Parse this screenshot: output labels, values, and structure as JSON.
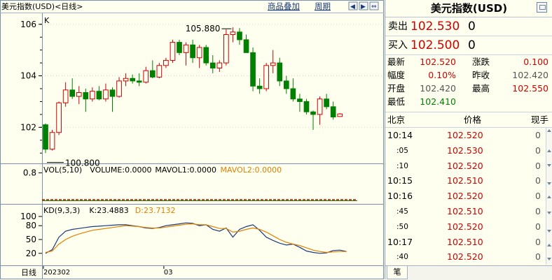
{
  "header": {
    "title": "美元指数(USD)<日线>",
    "overlay_label": "商品叠加",
    "period_label": "周期"
  },
  "chart_data": [
    {
      "type": "candlestick",
      "title": "K",
      "ylim": [
        100.6,
        106.4
      ],
      "yticks": [
        102,
        104,
        106
      ],
      "up_color": "#d00000",
      "down_color": "#008000",
      "candles": [
        {
          "o": 102.1,
          "h": 102.15,
          "l": 101.0,
          "c": 101.15
        },
        {
          "o": 101.15,
          "h": 101.9,
          "l": 101.1,
          "c": 101.8
        },
        {
          "o": 101.8,
          "h": 103.0,
          "l": 101.7,
          "c": 102.95
        },
        {
          "o": 102.95,
          "h": 103.75,
          "l": 102.8,
          "c": 103.45
        },
        {
          "o": 103.45,
          "h": 103.9,
          "l": 103.1,
          "c": 103.2
        },
        {
          "o": 103.2,
          "h": 103.6,
          "l": 102.9,
          "c": 103.35
        },
        {
          "o": 103.35,
          "h": 103.5,
          "l": 102.6,
          "c": 103.1
        },
        {
          "o": 103.1,
          "h": 103.55,
          "l": 103.0,
          "c": 103.4
        },
        {
          "o": 103.4,
          "h": 103.6,
          "l": 103.05,
          "c": 103.1
        },
        {
          "o": 103.1,
          "h": 103.7,
          "l": 103.0,
          "c": 103.45
        },
        {
          "o": 103.45,
          "h": 103.55,
          "l": 102.6,
          "c": 103.2
        },
        {
          "o": 103.2,
          "h": 103.95,
          "l": 103.15,
          "c": 103.8
        },
        {
          "o": 103.8,
          "h": 104.1,
          "l": 103.6,
          "c": 103.9
        },
        {
          "o": 103.9,
          "h": 104.05,
          "l": 103.7,
          "c": 103.8
        },
        {
          "o": 103.8,
          "h": 104.1,
          "l": 103.6,
          "c": 103.75
        },
        {
          "o": 103.75,
          "h": 104.35,
          "l": 103.7,
          "c": 104.2
        },
        {
          "o": 104.2,
          "h": 104.6,
          "l": 103.9,
          "c": 103.95
        },
        {
          "o": 103.95,
          "h": 104.5,
          "l": 103.9,
          "c": 104.4
        },
        {
          "o": 104.4,
          "h": 104.7,
          "l": 104.3,
          "c": 104.6
        },
        {
          "o": 104.6,
          "h": 105.4,
          "l": 104.5,
          "c": 105.3
        },
        {
          "o": 105.3,
          "h": 105.4,
          "l": 104.8,
          "c": 104.9
        },
        {
          "o": 104.9,
          "h": 105.3,
          "l": 104.4,
          "c": 105.2
        },
        {
          "o": 105.2,
          "h": 105.4,
          "l": 104.5,
          "c": 104.7
        },
        {
          "o": 104.7,
          "h": 105.2,
          "l": 104.3,
          "c": 105.1
        },
        {
          "o": 105.1,
          "h": 105.2,
          "l": 104.4,
          "c": 104.5
        },
        {
          "o": 104.5,
          "h": 104.8,
          "l": 104.1,
          "c": 104.3
        },
        {
          "o": 104.3,
          "h": 104.6,
          "l": 104.15,
          "c": 104.5
        },
        {
          "o": 104.5,
          "h": 105.8,
          "l": 104.4,
          "c": 105.6
        },
        {
          "o": 105.6,
          "h": 105.88,
          "l": 105.3,
          "c": 105.7
        },
        {
          "o": 105.7,
          "h": 105.85,
          "l": 105.2,
          "c": 105.4
        },
        {
          "o": 105.4,
          "h": 105.6,
          "l": 104.9,
          "c": 104.9
        },
        {
          "o": 104.9,
          "h": 105.1,
          "l": 103.4,
          "c": 103.6
        },
        {
          "o": 103.6,
          "h": 103.9,
          "l": 103.3,
          "c": 103.5
        },
        {
          "o": 103.5,
          "h": 104.5,
          "l": 103.4,
          "c": 104.4
        },
        {
          "o": 104.4,
          "h": 105.0,
          "l": 104.1,
          "c": 104.5
        },
        {
          "o": 104.5,
          "h": 104.7,
          "l": 103.6,
          "c": 103.8
        },
        {
          "o": 103.8,
          "h": 104.0,
          "l": 103.3,
          "c": 103.5
        },
        {
          "o": 103.5,
          "h": 103.9,
          "l": 103.0,
          "c": 103.1
        },
        {
          "o": 103.1,
          "h": 103.3,
          "l": 102.6,
          "c": 103.0
        },
        {
          "o": 103.0,
          "h": 103.1,
          "l": 102.5,
          "c": 102.6
        },
        {
          "o": 102.6,
          "h": 102.65,
          "l": 101.9,
          "c": 102.5
        },
        {
          "o": 102.5,
          "h": 103.2,
          "l": 102.1,
          "c": 103.1
        },
        {
          "o": 103.1,
          "h": 103.3,
          "l": 102.7,
          "c": 102.8
        },
        {
          "o": 102.8,
          "h": 103.0,
          "l": 102.3,
          "c": 102.4
        },
        {
          "o": 102.42,
          "h": 102.55,
          "l": 102.41,
          "c": 102.52
        }
      ],
      "annotations": [
        {
          "label": "105.880",
          "index": 28,
          "value": 105.88,
          "side": "left"
        },
        {
          "label": "100.800",
          "index": 0,
          "value": 100.8,
          "side": "right"
        }
      ]
    },
    {
      "type": "bar",
      "legend": [
        {
          "text": "VOL(5,10)",
          "color": "#000000"
        },
        {
          "text": "VOLUME:0.0000",
          "color": "#000000"
        },
        {
          "text": "MAVOL1:0.0000",
          "color": "#000000"
        },
        {
          "text": "MAVOL2:0.0000",
          "color": "#e08000"
        }
      ],
      "ylim": [
        0,
        1
      ],
      "yticks": [
        0.8
      ]
    },
    {
      "type": "line",
      "legend": [
        {
          "text": "KD(9,3,3)",
          "color": "#000000"
        },
        {
          "text": "K:23.4883",
          "color": "#000000"
        },
        {
          "text": "D:23.7132",
          "color": "#e08000"
        }
      ],
      "ylim": [
        0,
        100
      ],
      "yticks": [
        100,
        80,
        50,
        20
      ],
      "series": [
        {
          "name": "K",
          "color": "#1a3a7a",
          "values": [
            20,
            28,
            55,
            68,
            72,
            74,
            76,
            78,
            79,
            80,
            81,
            82,
            82,
            80,
            78,
            75,
            74,
            76,
            80,
            82,
            84,
            86,
            85,
            80,
            82,
            72,
            68,
            75,
            55,
            72,
            78,
            82,
            70,
            55,
            48,
            42,
            38,
            40,
            33,
            25,
            22,
            20,
            21,
            26,
            27,
            24
          ]
        },
        {
          "name": "D",
          "color": "#e08000",
          "values": [
            22,
            25,
            40,
            50,
            57,
            62,
            66,
            70,
            72,
            74,
            76,
            78,
            80,
            79,
            78,
            76,
            75,
            75,
            77,
            79,
            81,
            83,
            84,
            82,
            82,
            78,
            74,
            74,
            66,
            68,
            72,
            75,
            72,
            66,
            58,
            50,
            44,
            40,
            37,
            32,
            27,
            24,
            22,
            23,
            24,
            24
          ]
        }
      ]
    }
  ],
  "axis": {
    "period_label": "日线",
    "x_labels": [
      {
        "text": "202302",
        "index": 0
      },
      {
        "text": "03",
        "index": 18
      }
    ]
  },
  "quote": {
    "title": "美元指数(USD)",
    "sell_label": "卖出",
    "sell_price": "102.530",
    "sell_vol": "0",
    "buy_label": "买入",
    "buy_price": "102.500",
    "buy_vol": "0",
    "stats": {
      "latest_label": "最新",
      "latest": "102.520",
      "change_label": "涨跌",
      "change": "0.100",
      "pct_label": "幅度",
      "pct": "0.10%",
      "prev_label": "昨收",
      "prev": "102.420",
      "open_label": "开盘",
      "open": "102.420",
      "high_label": "最高",
      "high": "102.550",
      "low_label": "最低",
      "low": "102.410"
    },
    "ticks_header": {
      "time": "北京",
      "price": "价格",
      "vol": "现手"
    },
    "ticks": [
      {
        "time": "10:14",
        "sub": false,
        "price": "102.520",
        "vol": "0"
      },
      {
        "time": ":05",
        "sub": true,
        "price": "102.530",
        "vol": "0"
      },
      {
        "time": ":10",
        "sub": true,
        "price": "102.520",
        "vol": "0"
      },
      {
        "time": "10:15",
        "sub": false,
        "price": "102.510",
        "vol": "0"
      },
      {
        "time": "10:16",
        "sub": false,
        "price": "102.520",
        "vol": "0"
      },
      {
        "time": ":45",
        "sub": true,
        "price": "102.510",
        "vol": "0"
      },
      {
        "time": ":50",
        "sub": true,
        "price": "102.520",
        "vol": "0"
      },
      {
        "time": "10:17",
        "sub": false,
        "price": "102.510",
        "vol": "0"
      },
      {
        "time": ":40",
        "sub": true,
        "price": "102.520",
        "vol": "0"
      }
    ],
    "tab_label": "笔"
  }
}
